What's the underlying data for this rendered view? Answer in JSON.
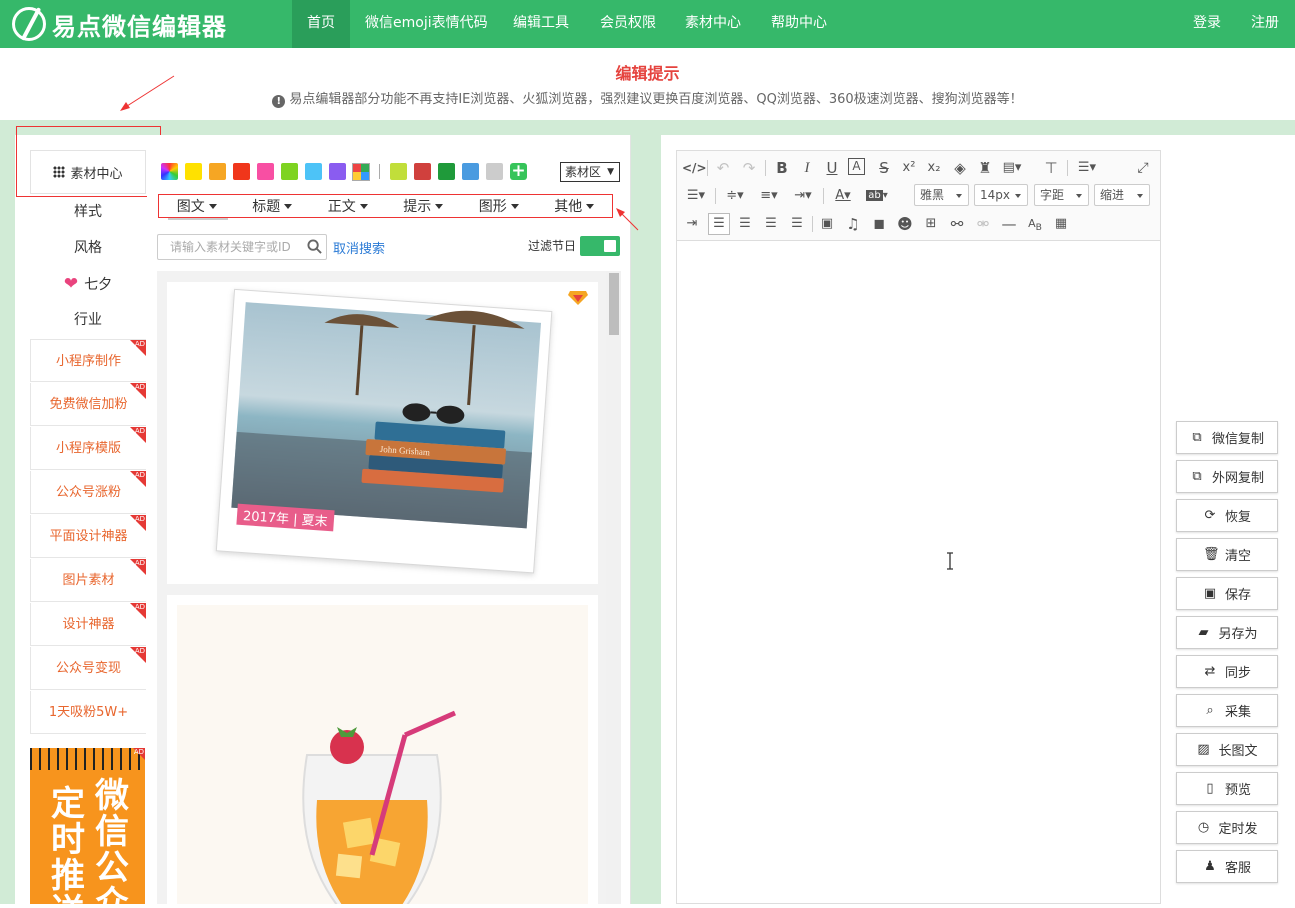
{
  "header": {
    "logo_text": "易点微信编辑器",
    "nav": [
      "首页",
      "微信emoji表情代码",
      "编辑工具",
      "会员权限",
      "素材中心",
      "帮助中心"
    ],
    "login": "登录",
    "register": "注册"
  },
  "notice": {
    "title": "编辑提示",
    "text": "易点编辑器部分功能不再支持IE浏览器、火狐浏览器，强烈建议更换百度浏览器、QQ浏览器、360极速浏览器、搜狗浏览器等！"
  },
  "leftnav": {
    "header": "素材中心",
    "items": [
      "样式",
      "风格",
      "七夕",
      "行业"
    ],
    "ads": [
      "小程序制作",
      "免费微信加粉",
      "小程序模版",
      "公众号涨粉",
      "平面设计神器",
      "图片素材",
      "设计神器",
      "公众号变现",
      "1天吸粉5W+"
    ],
    "ad_tag": "AD",
    "banner_col1": "定时推送",
    "banner_col2": "微信公众"
  },
  "material": {
    "swatch_colors": [
      "#ffe100",
      "#f6a623",
      "#f0361b",
      "#f84fa3",
      "#7ed321",
      "#4dc3f7",
      "#8a5cf0"
    ],
    "swatch_colors_2": [
      "#c1de3a",
      "#d0403d",
      "#1f9a3a",
      "#4a9be0",
      "#cccccc"
    ],
    "region_select": "素材区",
    "categories": [
      "图文",
      "标题",
      "正文",
      "提示",
      "图形",
      "其他"
    ],
    "search_placeholder": "请输入素材关键字或ID",
    "cancel_search": "取消搜索",
    "filter_label": "过滤节日",
    "card1_caption_year": "2017年",
    "card1_caption_season": "夏末",
    "book_labels": [
      "John Grisham"
    ]
  },
  "editor": {
    "font_family": "雅黑",
    "font_size": "14px",
    "letter_spacing": "字距",
    "indent": "缩进"
  },
  "side_buttons": [
    {
      "label": "微信复制",
      "icon": "copy-icon"
    },
    {
      "label": "外网复制",
      "icon": "copy-icon"
    },
    {
      "label": "恢复",
      "icon": "refresh-icon"
    },
    {
      "label": "清空",
      "icon": "trash-icon"
    },
    {
      "label": "保存",
      "icon": "save-icon"
    },
    {
      "label": "另存为",
      "icon": "folder-open-icon"
    },
    {
      "label": "同步",
      "icon": "sync-icon"
    },
    {
      "label": "采集",
      "icon": "search-icon"
    },
    {
      "label": "长图文",
      "icon": "image-icon"
    },
    {
      "label": "预览",
      "icon": "mobile-icon"
    },
    {
      "label": "定时发",
      "icon": "clock-icon"
    },
    {
      "label": "客服",
      "icon": "qq-icon"
    }
  ],
  "colors": {
    "brand_green": "#36b86a",
    "accent_red": "#e5433e",
    "ad_orange": "#e8662e"
  }
}
